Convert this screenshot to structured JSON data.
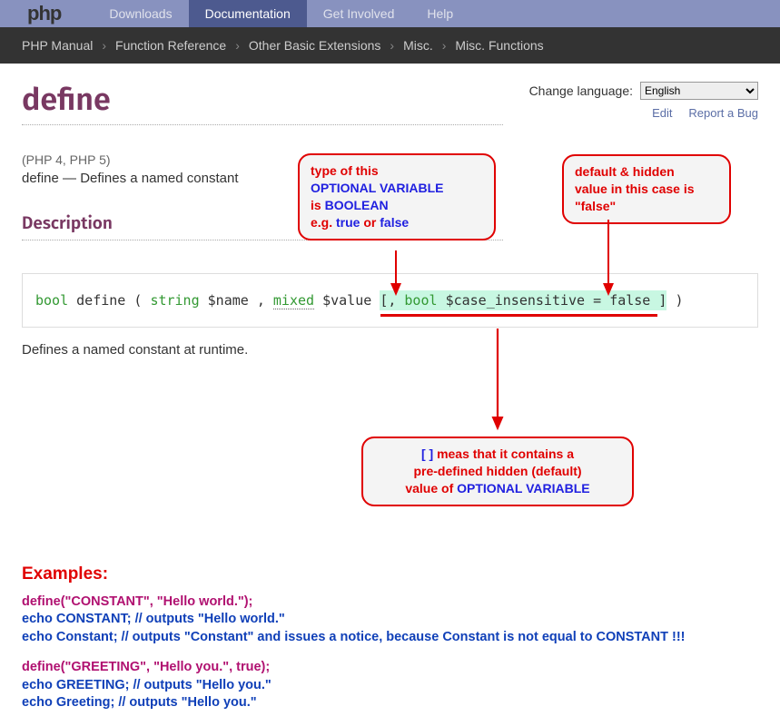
{
  "nav": {
    "logo": "php",
    "items": [
      "Downloads",
      "Documentation",
      "Get Involved",
      "Help"
    ],
    "active": 1
  },
  "breadcrumb": [
    "PHP Manual",
    "Function Reference",
    "Other Basic Extensions",
    "Misc.",
    "Misc. Functions"
  ],
  "language": {
    "label": "Change language:",
    "selected": "English"
  },
  "links": {
    "edit": "Edit",
    "report": "Report a Bug"
  },
  "page": {
    "title": "define",
    "versions": "(PHP 4, PHP 5)",
    "summary_a": "define — ",
    "summary_b": "Defines a named constant",
    "description_heading": "Description",
    "runtime": "Defines a named constant at runtime."
  },
  "signature": {
    "ret_type": "bool",
    "func": "define",
    "p1_type": "string",
    "p1_name": "$name",
    "p2_type": "mixed",
    "p2_name": "$value",
    "opt_open": "[, ",
    "p3_type": "bool",
    "p3_name": "$case_insensitive",
    "eq": " = ",
    "p3_default": "false",
    "opt_close": " ]",
    "paren_open": " ( ",
    "comma": " , ",
    "paren_close": " )"
  },
  "annotations": {
    "a1_l1": "type of this",
    "a1_l2": "OPTIONAL VARIABLE",
    "a1_l3a": "is ",
    "a1_l3b": "BOOLEAN",
    "a1_l4a": "e.g. ",
    "a1_l4b": "true",
    "a1_l4c": " or ",
    "a1_l4d": "false",
    "a2_l1": "default & hidden",
    "a2_l2": "value in this case is",
    "a2_l3": "\"false\"",
    "a3_l1a": "[ ]",
    "a3_l1b": " meas that it contains a",
    "a3_l2": "pre-defined hidden (default)",
    "a3_l3a": "value of  ",
    "a3_l3b": "OPTIONAL VARIABLE"
  },
  "examples": {
    "heading": "Examples:",
    "l1": "define(\"CONSTANT\", \"Hello world.\");",
    "l2": "echo CONSTANT; // outputs \"Hello world.\"",
    "l3": "echo Constant; // outputs \"Constant\" and issues a notice, because Constant is not equal to CONSTANT !!!",
    "l4": "define(\"GREETING\", \"Hello you.\", true);",
    "l5": "echo GREETING; // outputs \"Hello you.\"",
    "l6": "echo Greeting; // outputs \"Hello you.\""
  }
}
